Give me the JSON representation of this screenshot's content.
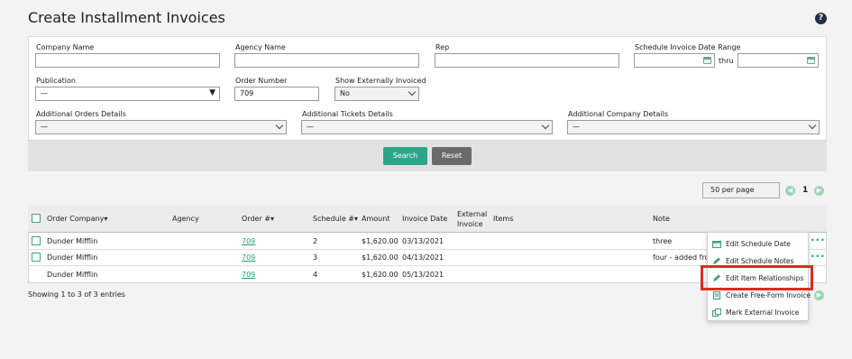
{
  "page": {
    "title": "Create Installment Invoices",
    "help": "?"
  },
  "filters": {
    "company_name_label": "Company Name",
    "company_name_value": "",
    "agency_name_label": "Agency Name",
    "agency_name_value": "",
    "rep_label": "Rep",
    "rep_value": "",
    "schedule_range_label": "Schedule Invoice Date Range",
    "thru": "thru",
    "publication_label": "Publication",
    "publication_value": "—",
    "order_number_label": "Order Number",
    "order_number_value": "709",
    "show_ext_label": "Show Externally Invoiced",
    "show_ext_value": "No",
    "add_orders_label": "Additional Orders Details",
    "add_orders_value": "—",
    "add_tickets_label": "Additional Tickets Details",
    "add_tickets_value": "—",
    "add_company_label": "Additional Company Details",
    "add_company_value": "—",
    "search_label": "Search",
    "reset_label": "Reset"
  },
  "pager": {
    "per_page": "50 per page",
    "page": "1"
  },
  "table": {
    "headers": {
      "order_company": "Order Company▾",
      "agency": "Agency",
      "order_num": "Order #▾",
      "schedule_num": "Schedule #▾",
      "amount": "Amount",
      "invoice_date": "Invoice Date",
      "external_invoice_1": "External",
      "external_invoice_2": "Invoice",
      "items": "Items",
      "note": "Note"
    },
    "rows": [
      {
        "company": "Dunder Mifflin",
        "order": "709",
        "schedule": "2",
        "amount": "$1,620.00",
        "date": "03/13/2021",
        "note": "three"
      },
      {
        "company": "Dunder Mifflin",
        "order": "709",
        "schedule": "3",
        "amount": "$1,620.00",
        "date": "04/13/2021",
        "note": "four - added fror"
      },
      {
        "company": "Dunder Mifflin",
        "order": "709",
        "schedule": "4",
        "amount": "$1,620.00",
        "date": "05/13/2021",
        "note": ""
      }
    ],
    "showing": "Showing 1 to 3 of 3 entries"
  },
  "menu": {
    "items": [
      {
        "label": "Edit Schedule Date",
        "icon": "calendar-icon"
      },
      {
        "label": "Edit Schedule Notes",
        "icon": "pencil-icon"
      },
      {
        "label": "Edit Item Relationships",
        "icon": "pencil-icon"
      },
      {
        "label": "Create Free-Form Invoice",
        "icon": "document-icon"
      },
      {
        "label": "Mark External Invoice",
        "icon": "copy-icon"
      }
    ]
  },
  "colors": {
    "accent": "#2aa789",
    "highlight": "#e02a1e",
    "link": "#2a9c6f"
  }
}
